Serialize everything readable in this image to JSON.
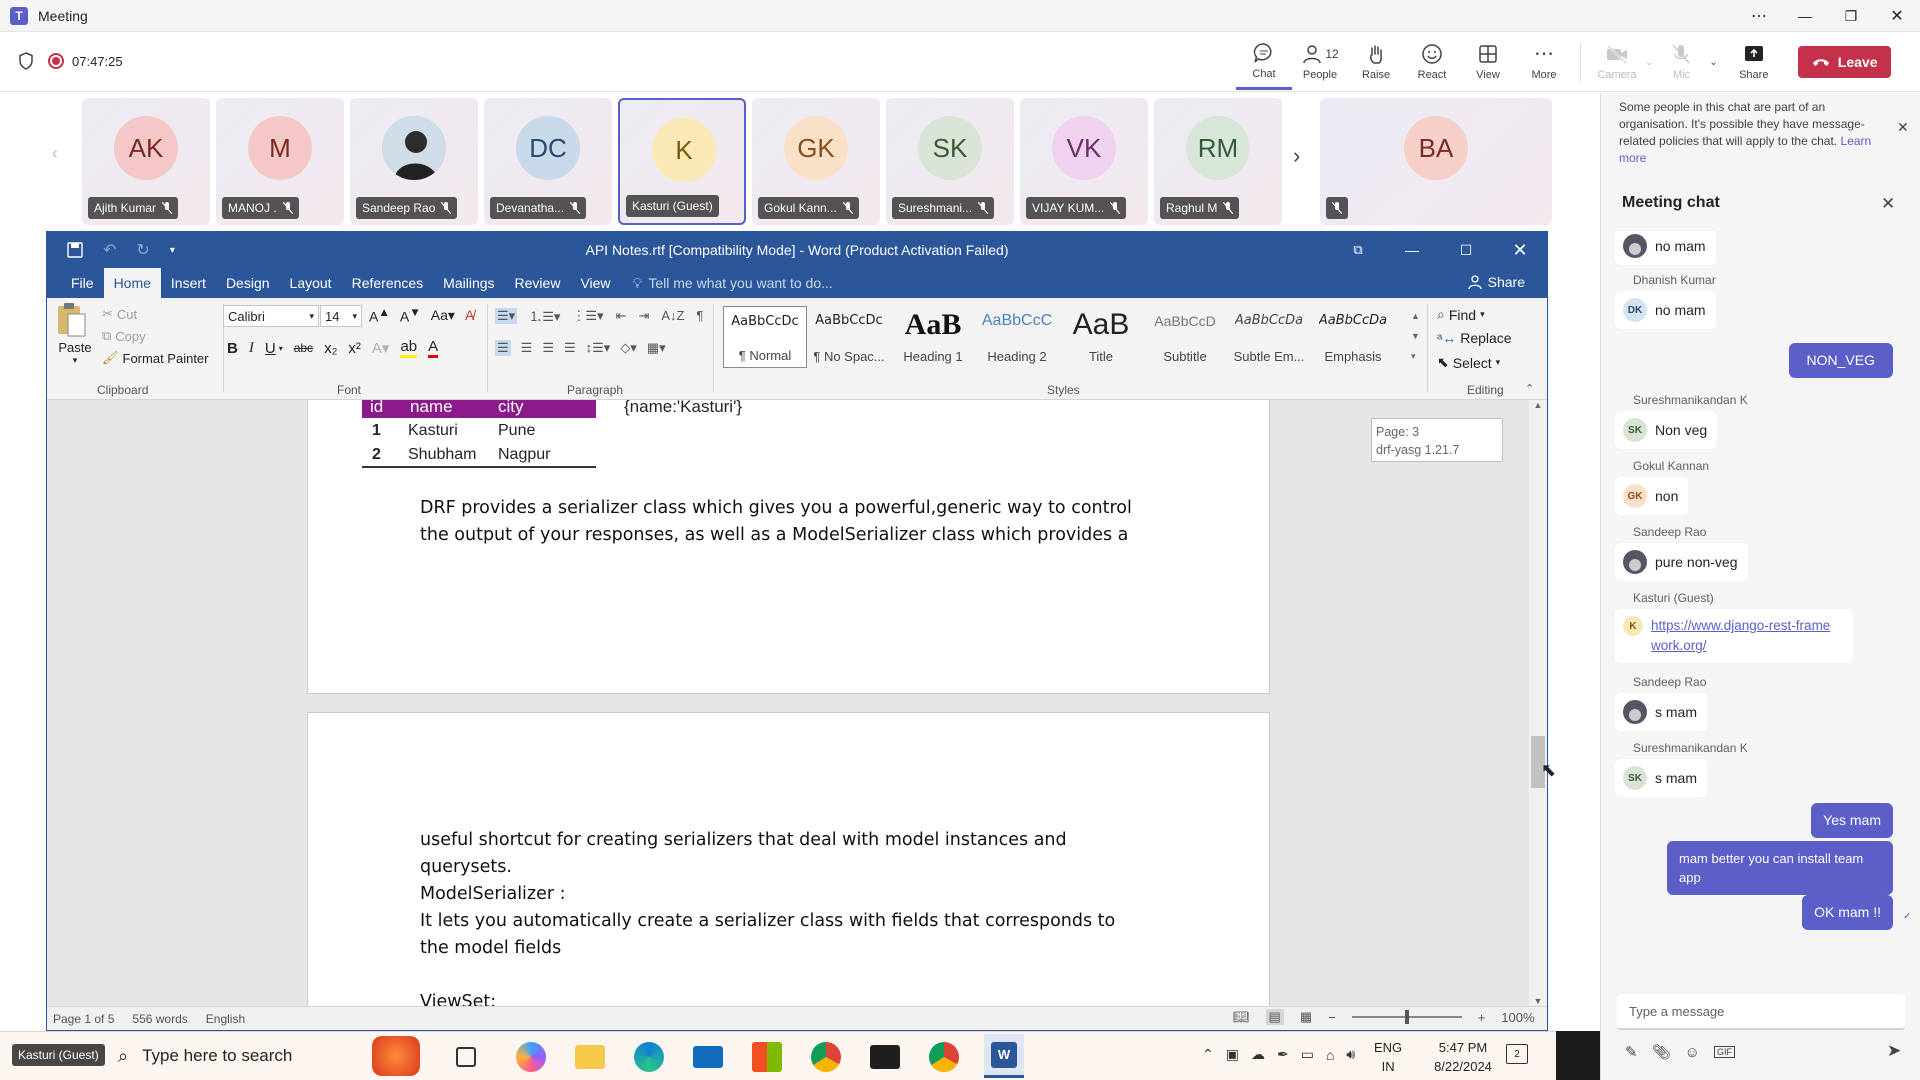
{
  "teams": {
    "app_title": "Meeting",
    "timer": "07:47:25",
    "toolbar": {
      "chat": "Chat",
      "people": "People",
      "people_count": "12",
      "raise": "Raise",
      "react": "React",
      "view": "View",
      "more": "More",
      "camera": "Camera",
      "mic": "Mic",
      "share": "Share",
      "leave": "Leave"
    },
    "participants": [
      {
        "initials": "AK",
        "name": "Ajith Kumar",
        "color": "#f4c8c6",
        "text": "#7a2b24"
      },
      {
        "initials": "M",
        "name": "MANOJ .",
        "color": "#f4c8c6",
        "text": "#7a2b24"
      },
      {
        "initials": "",
        "name": "Sandeep Rao",
        "color": "#b7c9d6",
        "text": "#333"
      },
      {
        "initials": "DC",
        "name": "Devanatha...",
        "color": "#c8d9ea",
        "text": "#2b4a6e"
      },
      {
        "initials": "K",
        "name": "Kasturi (Guest)",
        "color": "#fbe9b5",
        "text": "#7a5b12"
      },
      {
        "initials": "GK",
        "name": "Gokul Kann...",
        "color": "#fbe0c8",
        "text": "#8a4e1d"
      },
      {
        "initials": "SK",
        "name": "Sureshmani...",
        "color": "#d9e4d6",
        "text": "#3d5a35"
      },
      {
        "initials": "VK",
        "name": "VIJAY KUM...",
        "color": "#eed2ee",
        "text": "#6e2d6e"
      },
      {
        "initials": "RM",
        "name": "Raghul M",
        "color": "#d8e6d9",
        "text": "#345c3a"
      }
    ],
    "extra_tile_initials": "BA"
  },
  "word": {
    "title": "API Notes.rtf [Compatibility Mode] - Word (Product Activation Failed)",
    "tabs": [
      "File",
      "Home",
      "Insert",
      "Design",
      "Layout",
      "References",
      "Mailings",
      "Review",
      "View"
    ],
    "tell_me": "Tell me what you want to do...",
    "share": "Share",
    "clipboard": {
      "paste": "Paste",
      "cut": "Cut",
      "copy": "Copy",
      "format_painter": "Format Painter",
      "group": "Clipboard"
    },
    "font": {
      "name": "Calibri",
      "size": "14",
      "group": "Font"
    },
    "paragraph_group": "Paragraph",
    "styles": [
      {
        "preview": "AaBbCcDc",
        "name": "¶ Normal"
      },
      {
        "preview": "AaBbCcDc",
        "name": "¶ No Spac..."
      },
      {
        "preview": "AaB",
        "name": "Heading 1"
      },
      {
        "preview": "AaBbCcC",
        "name": "Heading 2"
      },
      {
        "preview": "AaB",
        "name": "Title"
      },
      {
        "preview": "AaBbCcD",
        "name": "Subtitle"
      },
      {
        "preview": "AaBbCcDa",
        "name": "Subtle Em..."
      },
      {
        "preview": "AaBbCcDa",
        "name": "Emphasis"
      }
    ],
    "styles_group": "Styles",
    "editing": {
      "find": "Find",
      "replace": "Replace",
      "select": "Select",
      "group": "Editing"
    },
    "table": {
      "headers": [
        "id",
        "name",
        "city"
      ],
      "rows": [
        [
          "1",
          "Kasturi",
          "Pune"
        ],
        [
          "2",
          "Shubham",
          "Nagpur"
        ]
      ]
    },
    "json_snippet": "{name:'Kasturi'}",
    "page_tooltip": {
      "page": "Page: 3",
      "section": "drf-yasg 1.21.7"
    },
    "page1_lines": [
      "DRF provides a serializer class which gives you a powerful,generic way to control",
      "the output of your responses, as well as a ModelSerializer class which provides a"
    ],
    "page2_lines": [
      "useful shortcut for creating serializers that deal with model instances and",
      "querysets.",
      "ModelSerializer :",
      "It lets you automatically create a serializer class with fields that corresponds to",
      "the model fields",
      "",
      "ViewSet:"
    ],
    "status": {
      "page": "Page 1 of 5",
      "words": "556 words",
      "language": "English",
      "zoom": "100%"
    }
  },
  "panel": {
    "notice": "Some people in this chat are part of an organisation. It's possible they have message-related policies that will apply to the chat.",
    "learn_more": "Learn more",
    "chat_title": "Meeting chat",
    "messages": [
      {
        "sender": "",
        "avatar": "",
        "text": "no mam"
      },
      {
        "sender": "Dhanish Kumar",
        "avatar": "DK",
        "text": "no mam"
      },
      {
        "sender": "Sureshmanikandan K",
        "avatar": "SK",
        "text": "Non veg"
      },
      {
        "sender": "Gokul Kannan",
        "avatar": "GK",
        "text": "non"
      },
      {
        "sender": "Sandeep Rao",
        "avatar": "",
        "text": "pure non-veg"
      },
      {
        "sender": "Kasturi (Guest)",
        "avatar": "K",
        "text": "https://www.django-rest-framework.org/"
      },
      {
        "sender": "Sandeep Rao",
        "avatar": "",
        "text": "s mam"
      },
      {
        "sender": "Sureshmanikandan K",
        "avatar": "SK",
        "text": "s mam"
      }
    ],
    "my_messages": [
      "NON_VEG",
      "Yes mam",
      "mam better you can install team app",
      "OK mam !!"
    ],
    "compose_placeholder": "Type a message"
  },
  "taskbar": {
    "search_placeholder": "Type here to search",
    "presenter_label": "Kasturi (Guest)",
    "lang_top": "ENG",
    "lang_bottom": "IN",
    "time": "5:47 PM",
    "date": "8/22/2024",
    "notifications": "2"
  }
}
